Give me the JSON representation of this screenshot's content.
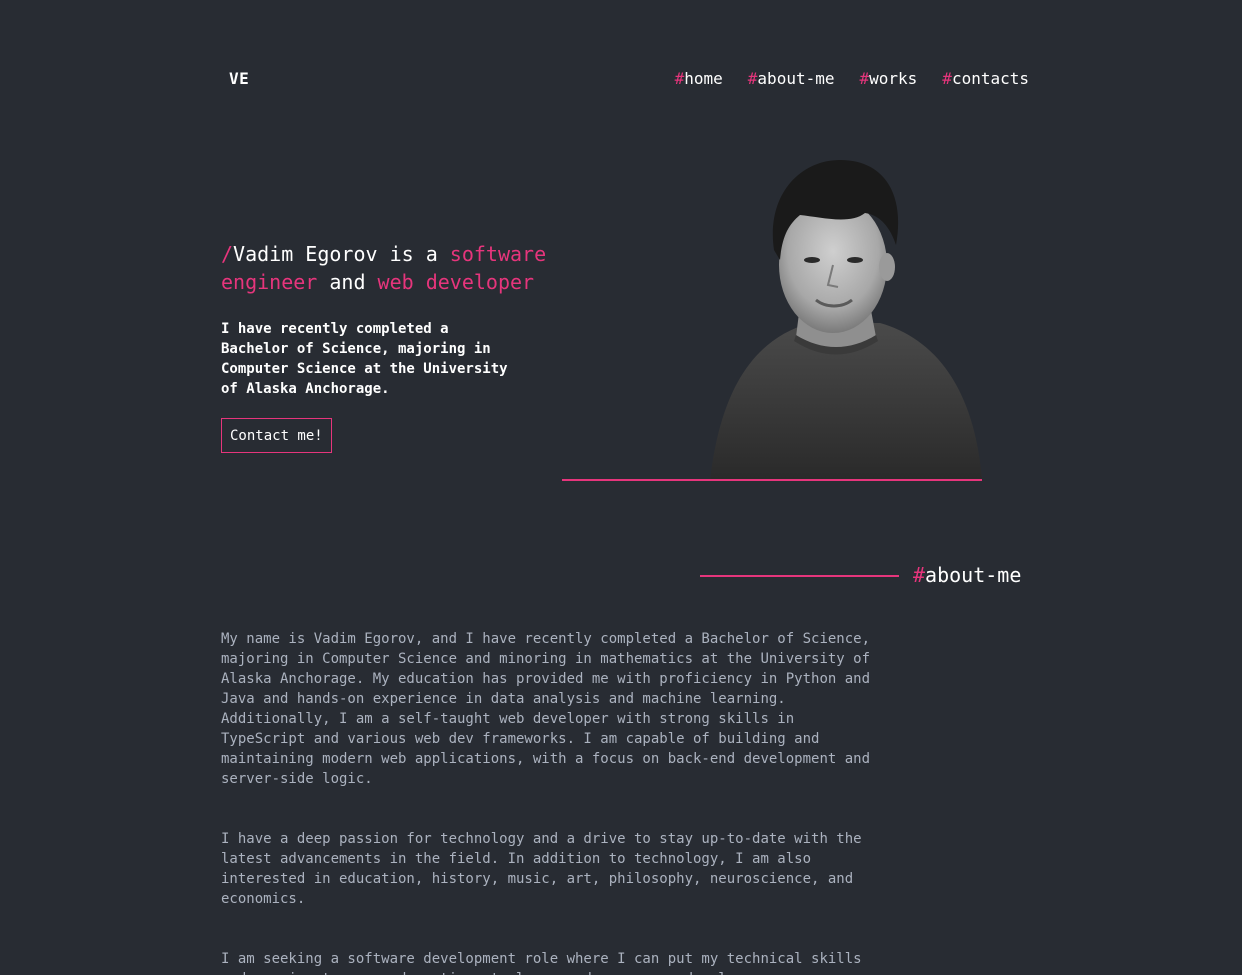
{
  "header": {
    "logo": "VE",
    "nav": [
      {
        "hash": "#",
        "label": "home"
      },
      {
        "hash": "#",
        "label": "about-me"
      },
      {
        "hash": "#",
        "label": "works"
      },
      {
        "hash": "#",
        "label": "contacts"
      }
    ]
  },
  "hero": {
    "slash": "/",
    "name": "Vadim Egorov is a ",
    "role1": "software engineer",
    "and": " and ",
    "role2": "web developer",
    "description": "I have recently completed a Bachelor of Science, majoring in Computer Science at the University of Alaska Anchorage.",
    "cta_label": "Contact me!"
  },
  "about": {
    "hash": "#",
    "heading": "about-me",
    "paragraphs": [
      "My name is Vadim Egorov, and I have recently completed a Bachelor of Science, majoring in Computer Science and minoring in mathematics at the University of Alaska Anchorage. My education has provided me with proficiency in Python and Java and hands-on experience in data analysis and machine learning. Additionally, I am a self-taught web developer with strong skills in TypeScript and various web dev frameworks. I am capable of building and maintaining modern web applications, with a focus on back-end development and server-side logic.",
      "I have a deep passion for technology and a drive to stay up-to-date with the latest advancements in the field. In addition to technology, I am also interested in education, history, music, art, philosophy, neuroscience, and economics.",
      "I am seeking a software development role where I can put my technical skills and passion to use and continue to learn and grow as a developer."
    ]
  },
  "colors": {
    "background": "#282c33",
    "accent": "#e6357c",
    "text": "#ffffff",
    "muted": "#abb2bf"
  }
}
